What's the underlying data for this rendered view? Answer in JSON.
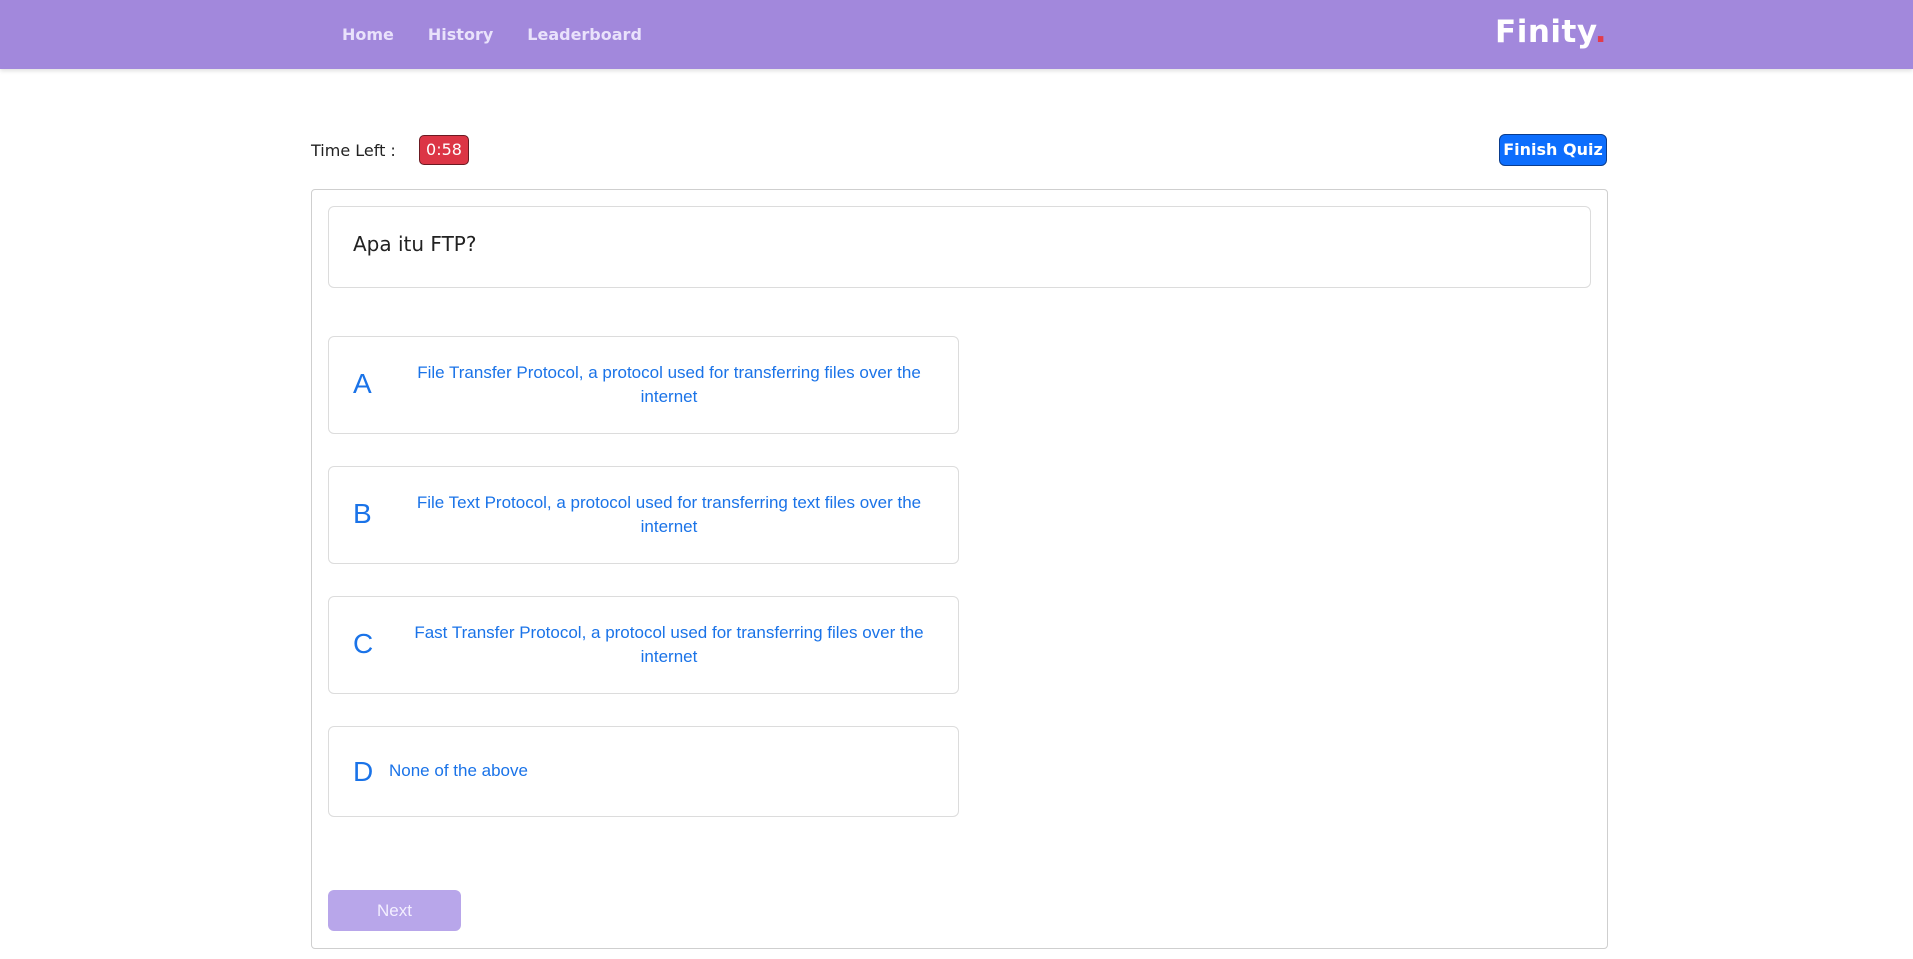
{
  "nav": {
    "links": [
      "Home",
      "History",
      "Leaderboard"
    ],
    "brand": "Finity",
    "brand_dot": "."
  },
  "quiz": {
    "time_label": "Time Left :",
    "timer": "0:58",
    "finish_label": "Finish Quiz",
    "question": "Apa itu FTP?",
    "options": [
      {
        "letter": "A",
        "text": "File Transfer Protocol, a protocol used for transferring files over the internet"
      },
      {
        "letter": "B",
        "text": "File Text Protocol, a protocol used for transferring text files over the internet"
      },
      {
        "letter": "C",
        "text": "Fast Transfer Protocol, a protocol used for transferring files over the internet"
      },
      {
        "letter": "D",
        "text": "None of the above"
      }
    ],
    "next_label": "Next"
  },
  "colors": {
    "navbar": "#a288dc",
    "timer_bg": "#dc3545",
    "finish_bg": "#0d6efd",
    "option_text": "#1a73e8",
    "next_bg": "#b8a6ea"
  }
}
